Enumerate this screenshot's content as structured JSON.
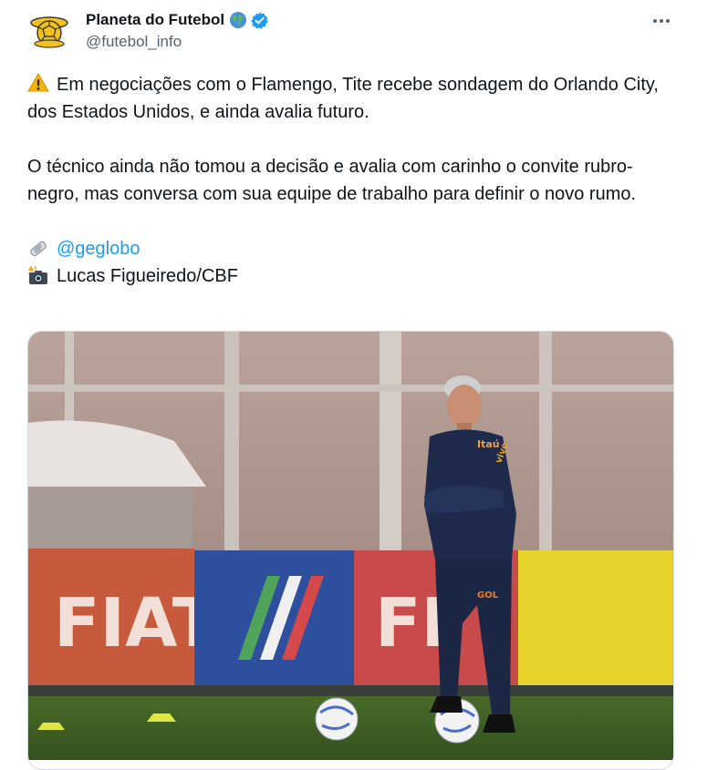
{
  "author": {
    "display_name": "Planeta do Futebol",
    "handle": "@futebol_info",
    "icons": [
      "globe-icon",
      "verified-badge-icon"
    ]
  },
  "tweet": {
    "line1": "Em negociações com o Flamengo, Tite recebe sondagem do Orlando City, dos Estados Unidos, e ainda avalia futuro.",
    "line2": "O técnico ainda não tomou a decisão e avalia com carinho o convite rubro-negro, mas conversa com sua equipe de trabalho para definir o novo rumo.",
    "source_mention": "@geglobo",
    "photo_credit": "Lucas Figueiredo/CBF",
    "emoji_icons": [
      "warning-icon",
      "newspaper-icon",
      "camera-flash-icon"
    ]
  },
  "media": {
    "banner_text_1": "FIAT",
    "banner_text_2": "FI",
    "shirt_sponsor": "Itaú",
    "shirt_sponsor_2": "vivo",
    "pants_logo": "GOL"
  },
  "colors": {
    "text": "#0f1419",
    "secondary": "#536471",
    "link": "#1d9bf0",
    "verified": "#1d9bf0"
  }
}
